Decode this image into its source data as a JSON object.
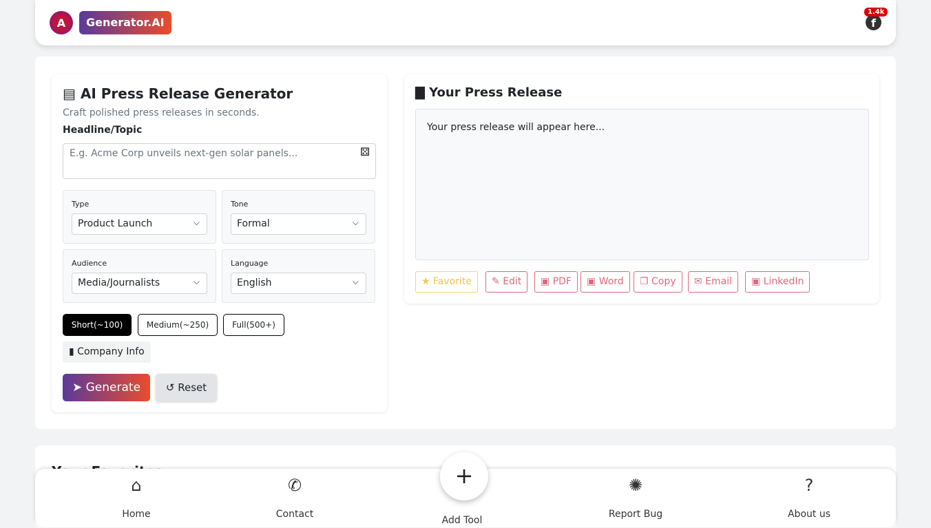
{
  "header": {
    "logo_text": "A",
    "brand": "Generator.AI",
    "fb_count": "1.4k"
  },
  "form": {
    "title": "AI Press Release Generator",
    "subtitle": "Craft polished press releases in seconds.",
    "headline_label": "Headline/Topic",
    "headline_placeholder": "E.g. Acme Corp unveils next-gen solar panels...",
    "type": {
      "label": "Type",
      "value": "Product Launch"
    },
    "tone": {
      "label": "Tone",
      "value": "Formal"
    },
    "audience": {
      "label": "Audience",
      "value": "Media/Journalists"
    },
    "language": {
      "label": "Language",
      "value": "English"
    },
    "lengths": [
      "Short(~100)",
      "Medium(~250)",
      "Full(500+)"
    ],
    "company_info": "Company Info",
    "generate": "Generate",
    "reset": "Reset"
  },
  "output": {
    "title": "Your Press Release",
    "placeholder": "Your press release will appear here...",
    "actions": [
      "Favorite",
      "Edit",
      "PDF",
      "Word",
      "Copy",
      "Email",
      "LinkedIn"
    ]
  },
  "favorites": {
    "title": "Your Favorites"
  },
  "nav": {
    "home": "Home",
    "contact": "Contact",
    "add": "Add Tool",
    "bug": "Report Bug",
    "about": "About us"
  },
  "colors": {
    "accent_start": "#5b3a9a",
    "accent_end": "#ea4c2c",
    "action": "#de6a7e",
    "favorite": "#f2c44d"
  }
}
